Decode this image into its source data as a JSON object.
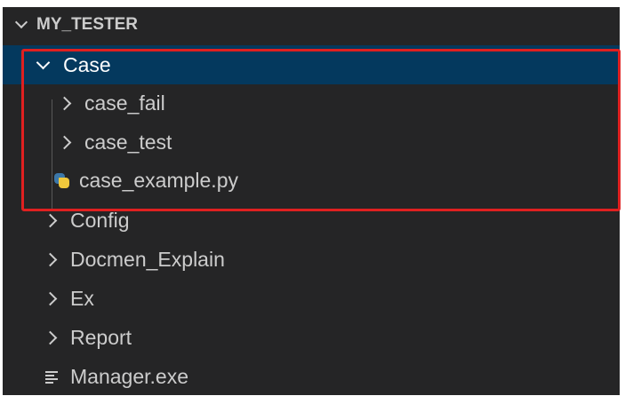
{
  "explorer": {
    "section_title": "MY_TESTER",
    "items": [
      {
        "label": "Case",
        "type": "folder",
        "expanded": true,
        "selected": true
      },
      {
        "label": "case_fail",
        "type": "folder",
        "expanded": false
      },
      {
        "label": "case_test",
        "type": "folder",
        "expanded": false
      },
      {
        "label": "case_example.py",
        "type": "python-file",
        "icon": "python-icon"
      },
      {
        "label": "Config",
        "type": "folder",
        "expanded": false
      },
      {
        "label": "Docmen_Explain",
        "type": "folder",
        "expanded": false
      },
      {
        "label": "Ex",
        "type": "folder",
        "expanded": false
      },
      {
        "label": "Report",
        "type": "folder",
        "expanded": false
      },
      {
        "label": "Manager.exe",
        "type": "file",
        "icon": "text-file-icon"
      }
    ]
  },
  "colors": {
    "background": "#252526",
    "selection": "#04395e",
    "highlight_box": "#e02020",
    "text": "#cccccc"
  }
}
